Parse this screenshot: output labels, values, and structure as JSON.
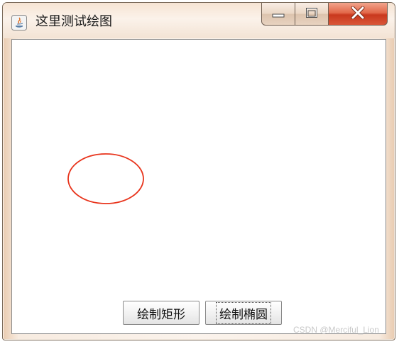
{
  "window": {
    "title": "这里测试绘图",
    "app_icon": "java-icon",
    "controls": {
      "minimize_icon": "minimize-icon",
      "maximize_icon": "maximize-icon",
      "close_icon": "close-icon"
    }
  },
  "canvas": {
    "shape": "ellipse",
    "stroke_color": "#e8341c"
  },
  "buttons": {
    "draw_rectangle": "绘制矩形",
    "draw_ellipse": "绘制椭圆"
  },
  "watermark": "CSDN @Merciful_Lion",
  "colors": {
    "close_button": "#d9502f",
    "frame": "#f3e2d2"
  }
}
